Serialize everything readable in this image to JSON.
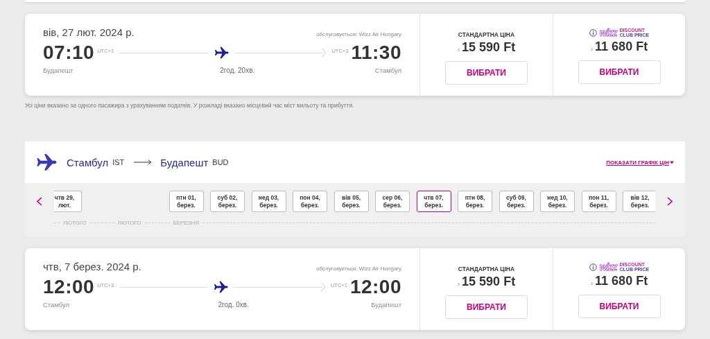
{
  "outbound": {
    "flight": {
      "date": "вів, 27 лют. 2024 р.",
      "operator": "обслуговується: Wizz Air Hungary",
      "departure": {
        "time": "07:10",
        "utc": "UTC+1",
        "city": "Будапешт"
      },
      "arrival": {
        "time": "11:30",
        "utc": "UTC+3",
        "city": "Стамбул"
      },
      "duration": "2год. 20хв.",
      "fares": [
        {
          "kind": "standard",
          "label": "СТАНДАРТНА ЦІНА",
          "prefix": "з",
          "price": "15 590 Ft",
          "button": "ВИБРАТИ"
        },
        {
          "kind": "club",
          "logo": "wizz",
          "label_top": "DISCOUNT",
          "label_bottom": "CLUB PRICE",
          "prefix": "з",
          "price": "11 680 Ft",
          "button": "ВИБРАТИ"
        }
      ]
    },
    "note": "Усі ціни вказано за одного пасажира з урахуванням податків. У розкладі вказано місцевий час міст вильоту та прибуття."
  },
  "return": {
    "route": {
      "from_city": "Стамбул",
      "from_code": "IST",
      "to_city": "Будапешт",
      "to_code": "BUD",
      "chart_link": "ПОКАЗАТИ ГРАФІК ЦІН"
    },
    "dates": [
      {
        "day": "чтв 29,",
        "month": "лют.",
        "selected": false
      },
      {
        "day": "птн 01,",
        "month": "берез.",
        "selected": false
      },
      {
        "day": "суб 02,",
        "month": "берез.",
        "selected": false
      },
      {
        "day": "нед 03,",
        "month": "берез.",
        "selected": false
      },
      {
        "day": "пон 04,",
        "month": "берез.",
        "selected": false
      },
      {
        "day": "вів 05,",
        "month": "берез.",
        "selected": false
      },
      {
        "day": "сер 06,",
        "month": "берез.",
        "selected": false
      },
      {
        "day": "чтв 07,",
        "month": "берез.",
        "selected": true
      },
      {
        "day": "птн 08,",
        "month": "берез.",
        "selected": false
      },
      {
        "day": "суб 09,",
        "month": "берез.",
        "selected": false
      },
      {
        "day": "нед 10,",
        "month": "берез.",
        "selected": false
      },
      {
        "day": "пон 11,",
        "month": "берез.",
        "selected": false
      },
      {
        "day": "вів 12,",
        "month": "берез.",
        "selected": false
      }
    ],
    "months": [
      "ЛЮТОГО",
      "ЛЮТОГО",
      "БЕРЕЗНЯ"
    ],
    "flight": {
      "date": "чтв, 7 берез. 2024 р.",
      "operator": "обслуговується: Wizz Air Hungary",
      "departure": {
        "time": "12:00",
        "utc": "UTC+3",
        "city": "Стамбул"
      },
      "arrival": {
        "time": "12:00",
        "utc": "UTC+1",
        "city": "Будапешт"
      },
      "duration": "2год. 0хв.",
      "fares": [
        {
          "kind": "standard",
          "label": "СТАНДАРТНА ЦІНА",
          "prefix": "з",
          "price": "15 590 Ft",
          "button": "ВИБРАТИ"
        },
        {
          "kind": "club",
          "logo": "wizz",
          "label_top": "DISCOUNT",
          "label_bottom": "CLUB PRICE",
          "prefix": "з",
          "price": "11 680 Ft",
          "button": "ВИБРАТИ"
        }
      ]
    }
  }
}
